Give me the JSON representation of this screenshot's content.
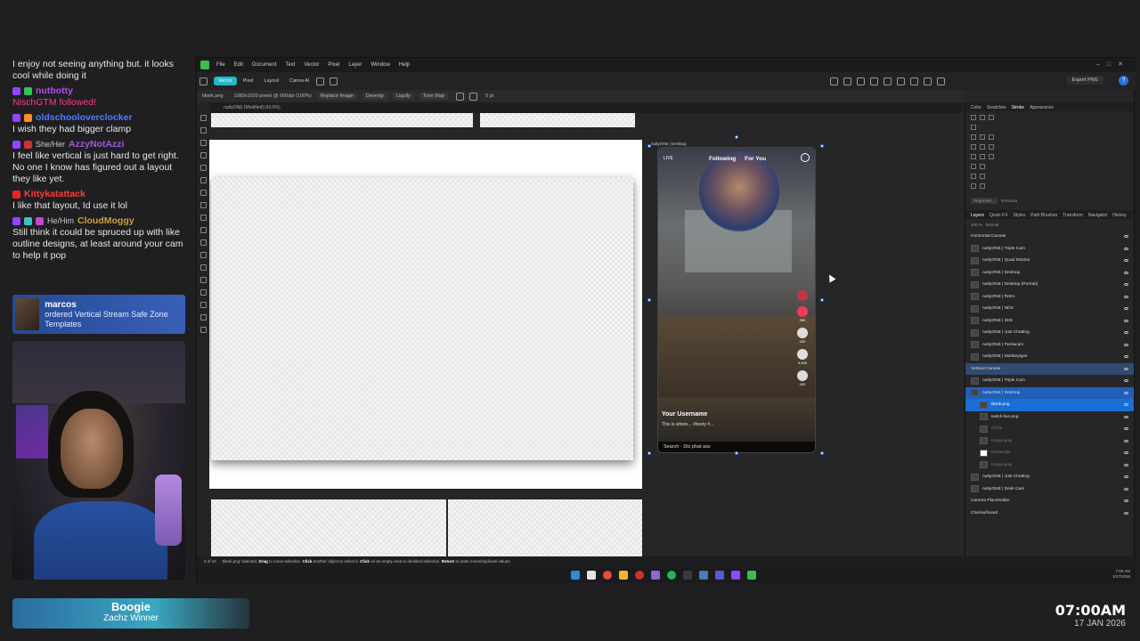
{
  "chat": {
    "messages": [
      {
        "text": "I enjoy not seeing anything but. it looks cool while doing it"
      },
      {
        "user": "nutbotty",
        "color": "#b44af0",
        "event": "NischGTM followed!",
        "event_color": "#ff3a86"
      },
      {
        "user": "oldschooloverclocker",
        "color": "#4f7dff",
        "text": "I wish they had bigger clamp"
      },
      {
        "user": "AzzyNotAzzi",
        "color": "#a05ad8",
        "pronoun": "She/Her",
        "text": "I feel like vertical is just hard to get right. No one I know has figured out a layout they like yet."
      },
      {
        "user": "Kittykatattack",
        "color": "#ff3a3a",
        "text": "I like that layout, Id use it lol"
      },
      {
        "user": "CloudMoggy",
        "color": "#c8a040",
        "pronoun": "He/Him",
        "text": "Still think it could be spruced up with like outline designs, at least around your cam to help it pop"
      }
    ]
  },
  "alert": {
    "name": "marcos",
    "text": "ordered Vertical Stream Safe Zone Templates"
  },
  "namecard": {
    "name": "Boogie",
    "subtitle": "Zachz Winner"
  },
  "clock": {
    "time": "07:00AM",
    "date": "17 JAN 2026"
  },
  "app": {
    "menu": [
      "File",
      "Edit",
      "Document",
      "Text",
      "Vector",
      "Pixel",
      "Layer",
      "Window",
      "Help"
    ],
    "personas": [
      "Vector",
      "Pixel",
      "Layout",
      "Canva AI"
    ],
    "export_label": "Export PNG",
    "context": {
      "file": "tiktok.png",
      "dims": "1080x1920 pixels @ 600dpi (100%)",
      "replace": "Replace Image",
      "buttons": [
        "Develop",
        "Liquify",
        "Tone Map"
      ],
      "stroke": "0 pt"
    },
    "doc_tab": "nuttyONE [Modified] (43.9%)",
    "artboard_label": "nuttyONE | Desktop",
    "phone": {
      "tabs": [
        "Following",
        "For You"
      ],
      "live": "LIVE",
      "counts": [
        "39K",
        "420",
        "420",
        "9,000",
        "420"
      ],
      "username": "Your Username",
      "caption": "This is where... #booty #...",
      "search": "Search · Dis phat ass"
    },
    "studio": {
      "top_tabs": [
        "Color",
        "Swatches",
        "Stroke",
        "Appearance"
      ],
      "layer_tabs": [
        "Layers",
        "Quick FX",
        "Styles",
        "Path Brushes",
        "Transform",
        "Navigator",
        "History"
      ],
      "opacity": "100 %",
      "blend": "Normal",
      "properties": "Properties...",
      "pressure": "Pressure",
      "layers": [
        "Horizontal Canvas",
        "nuttyONE | Triple Cam",
        "nuttyONE | Quad Monitor",
        "nuttyONE | Desktop",
        "nuttyONE | Desktop (Portrait)",
        "nuttyONE | Retro",
        "nuttyONE | NDS",
        "nuttyONE | 3DS",
        "nuttyONE | Just Chatting",
        "nuttyONE | Pentacam",
        "nuttyONE | Monkeytype",
        "Vertical Canvas",
        "nuttyONE | Triple Cam",
        "nuttyONE | Desktop",
        "tiktok.png",
        "twitch-live.png",
        "Circle",
        "Image.png",
        "Rectangle",
        "Image.png",
        "nuttyONE | Just Chatting",
        "nuttyONE | Desk Cam",
        "Camera Placeholder",
        "Checkerboard"
      ]
    },
    "status": {
      "page": "3 of 16",
      "text_a": "'tiktok.png' selected. ",
      "drag": "Drag",
      "text_b": " to move selection. ",
      "click": "Click",
      "text_c": " another object to select it. ",
      "click2": "Click",
      "text_d": " on an empty area to deselect selection. ",
      "ret": "Return",
      "text_e": " to enter move/duplicate values."
    },
    "tray": {
      "time": "7:00 AM",
      "date": "1/17/2026"
    }
  }
}
